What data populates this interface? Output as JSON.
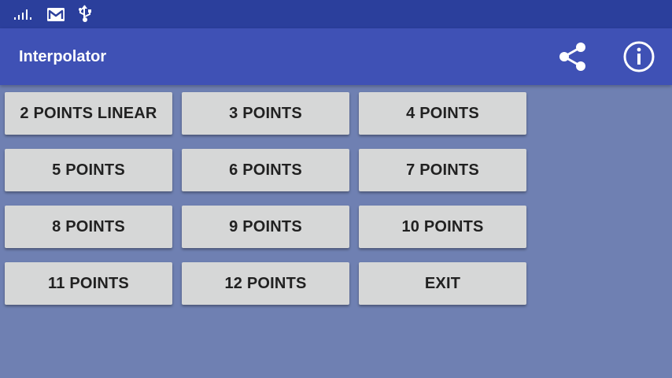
{
  "app": {
    "title": "Interpolator"
  },
  "status_bar": {
    "icons": [
      "signal-icon",
      "gmail-icon",
      "usb-icon"
    ]
  },
  "actions": {
    "share_icon": "share-icon",
    "info_icon": "info-icon"
  },
  "buttons": [
    "2 POINTS LINEAR",
    "3 POINTS",
    "4 POINTS",
    "5 POINTS",
    "6 POINTS",
    "7 POINTS",
    "8 POINTS",
    "9 POINTS",
    "10 POINTS",
    "11 POINTS",
    "12 POINTS",
    "EXIT"
  ],
  "colors": {
    "status_bar": "#2b3f9c",
    "app_bar": "#3f51b5",
    "background": "#6f80b2",
    "button": "#d6d7d7",
    "button_text": "#212121"
  }
}
